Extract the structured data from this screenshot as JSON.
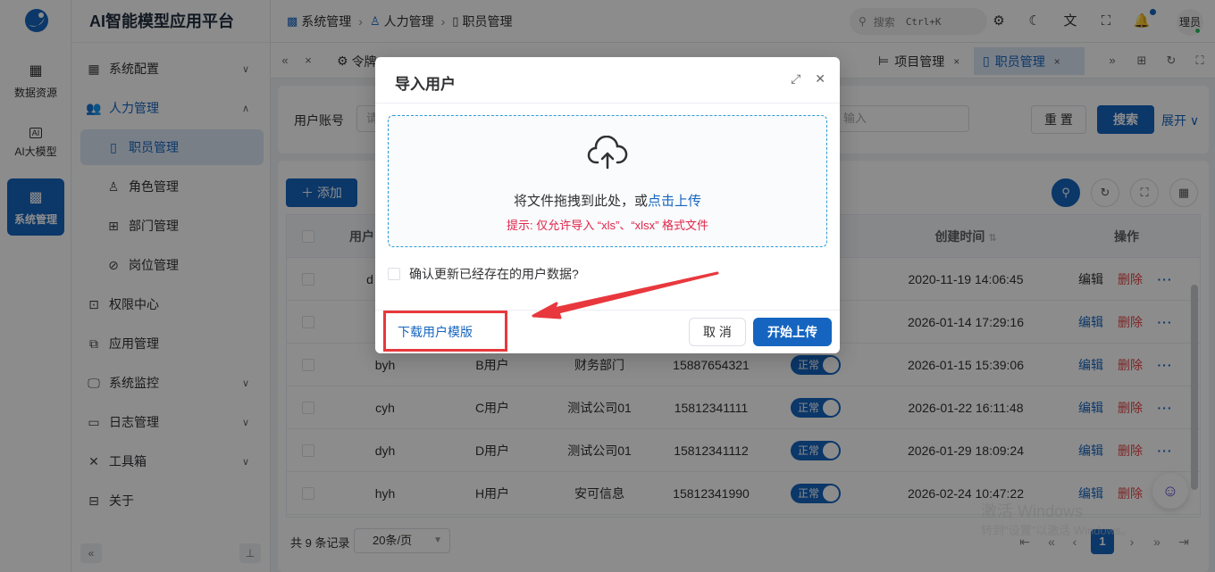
{
  "rail": {
    "items": [
      {
        "label": "数据资源",
        "icon": "database-icon"
      },
      {
        "label": "AI大模型",
        "icon": "ai-icon"
      },
      {
        "label": "系统管理",
        "icon": "system-icon"
      }
    ]
  },
  "sidebar": {
    "brand": "AI智能模型应用平台",
    "items": [
      {
        "label": "系统配置"
      },
      {
        "label": "人力管理"
      },
      {
        "label": "职员管理"
      },
      {
        "label": "角色管理"
      },
      {
        "label": "部门管理"
      },
      {
        "label": "岗位管理"
      },
      {
        "label": "权限中心"
      },
      {
        "label": "应用管理"
      },
      {
        "label": "系统监控"
      },
      {
        "label": "日志管理"
      },
      {
        "label": "工具箱"
      },
      {
        "label": "关于"
      }
    ]
  },
  "header": {
    "breadcrumb": [
      "系统管理",
      "人力管理",
      "职员管理"
    ],
    "search_placeholder": "搜索",
    "search_shortcut": "Ctrl+K",
    "avatar_text": "理员"
  },
  "tabs": {
    "items": [
      {
        "label": "令牌"
      },
      {
        "label": "项目管理"
      },
      {
        "label": "职员管理"
      }
    ]
  },
  "filter": {
    "account_label": "用户账号",
    "account_placeholder": "请",
    "other_placeholder": "输入",
    "reset_label": "重 置",
    "search_label": "搜索",
    "expand_label": "展开"
  },
  "toolbar": {
    "add_label": "添加"
  },
  "table": {
    "columns": {
      "account": "用户",
      "created": "创建时间",
      "actions": "操作"
    },
    "rows": [
      {
        "account": "d",
        "name": "",
        "dept": "",
        "phone": "",
        "status": "",
        "created": "2020-11-19 14:06:45"
      },
      {
        "account": "",
        "name": "",
        "dept": "",
        "phone": "",
        "status": "",
        "created": "2026-01-14 17:29:16"
      },
      {
        "account": "byh",
        "name": "B用户",
        "dept": "财务部门",
        "phone": "15887654321",
        "status": "正常",
        "created": "2026-01-15 15:39:06"
      },
      {
        "account": "cyh",
        "name": "C用户",
        "dept": "测试公司01",
        "phone": "15812341111",
        "status": "正常",
        "created": "2026-01-22 16:11:48"
      },
      {
        "account": "dyh",
        "name": "D用户",
        "dept": "测试公司01",
        "phone": "15812341112",
        "status": "正常",
        "created": "2026-01-29 18:09:24"
      },
      {
        "account": "hyh",
        "name": "H用户",
        "dept": "安可信息",
        "phone": "15812341990",
        "status": "正常",
        "created": "2026-02-24 10:47:22"
      }
    ],
    "edit_label": "编辑",
    "delete_label": "删除"
  },
  "pager": {
    "total": "共 9 条记录",
    "page_size": "20条/页",
    "current": "1"
  },
  "watermark": {
    "line1": "激活 Windows",
    "line2": "转到\"设置\"以激活 Windows。"
  },
  "modal": {
    "title": "导入用户",
    "drop_text": "将文件拖拽到此处，或",
    "drop_link": "点击上传",
    "tip": "提示: 仅允许导入 “xls”、“xlsx” 格式文件",
    "checkbox_label": "确认更新已经存在的用户数据?",
    "download_label": "下载用户模版",
    "cancel_label": "取 消",
    "ok_label": "开始上传"
  },
  "colors": {
    "primary": "#1565c0",
    "danger": "#e64545",
    "annotation": "#e8383d"
  }
}
